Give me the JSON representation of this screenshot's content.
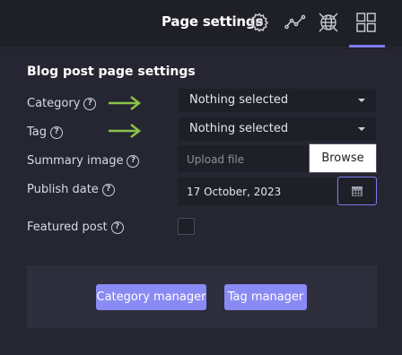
{
  "header": {
    "title": "Page settings",
    "icons": [
      "gear-icon",
      "line-chart-icon",
      "globe-icon",
      "grid-icon"
    ]
  },
  "form": {
    "section_title": "Blog post page settings",
    "category": {
      "label": "Category",
      "value": "Nothing selected"
    },
    "tag": {
      "label": "Tag",
      "value": "Nothing selected"
    },
    "summary_image": {
      "label": "Summary image",
      "placeholder": "Upload file",
      "browse_label": "Browse"
    },
    "publish_date": {
      "label": "Publish date",
      "value": "17 October, 2023"
    },
    "featured_post": {
      "label": "Featured post",
      "checked": false
    },
    "help_glyph": "?"
  },
  "footer": {
    "category_manager": "Category manager",
    "tag_manager": "Tag manager"
  },
  "colors": {
    "background": "#1f1f28",
    "panel": "#262632",
    "accent": "#8a8af5",
    "arrow": "#8bc34a"
  }
}
